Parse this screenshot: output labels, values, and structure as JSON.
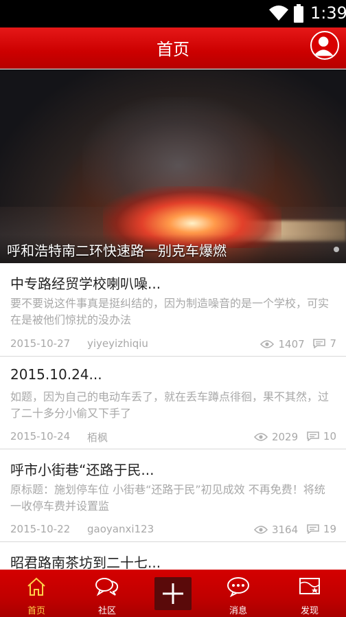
{
  "status_bar": {
    "time": "1:39"
  },
  "header": {
    "title": "首页",
    "avatar_icon": "user-avatar-icon"
  },
  "banner": {
    "caption": "呼和浩特南二环快速路一别克车爆燃"
  },
  "feed": [
    {
      "title": "中专路经贸学校喇叭噪...",
      "summary": "要不要说这件事真是挺纠结的，因为制造噪音的是一个学校，可实在是被他们惊扰的没办法",
      "date": "2015-10-27",
      "author": "yiyeyizhiqiu",
      "views": "1407",
      "comments": "7"
    },
    {
      "title": "2015.10.24...",
      "summary": "如题，因为自己的电动车丢了，就在丢车蹲点徘徊，果不其然，过了二十多分小偷又下手了",
      "date": "2015-10-24",
      "author": "栢枫",
      "views": "2029",
      "comments": "10"
    },
    {
      "title": "呼市小街巷“还路于民...",
      "summary": "原标题：施划停车位 小街巷“还路于民”初见成效 不再免费！将统一收停车费并设置监",
      "date": "2015-10-22",
      "author": "gaoyanxi123",
      "views": "3164",
      "comments": "19"
    },
    {
      "title": "昭君路南茶坊到二十七...",
      "summary": "",
      "date": "",
      "author": "",
      "views": "",
      "comments": ""
    }
  ],
  "tabbar": {
    "home": "首页",
    "community": "社区",
    "messages": "消息",
    "discover": "发现"
  },
  "colors": {
    "accent": "#cc0000",
    "active_tab": "#ffd24a"
  }
}
